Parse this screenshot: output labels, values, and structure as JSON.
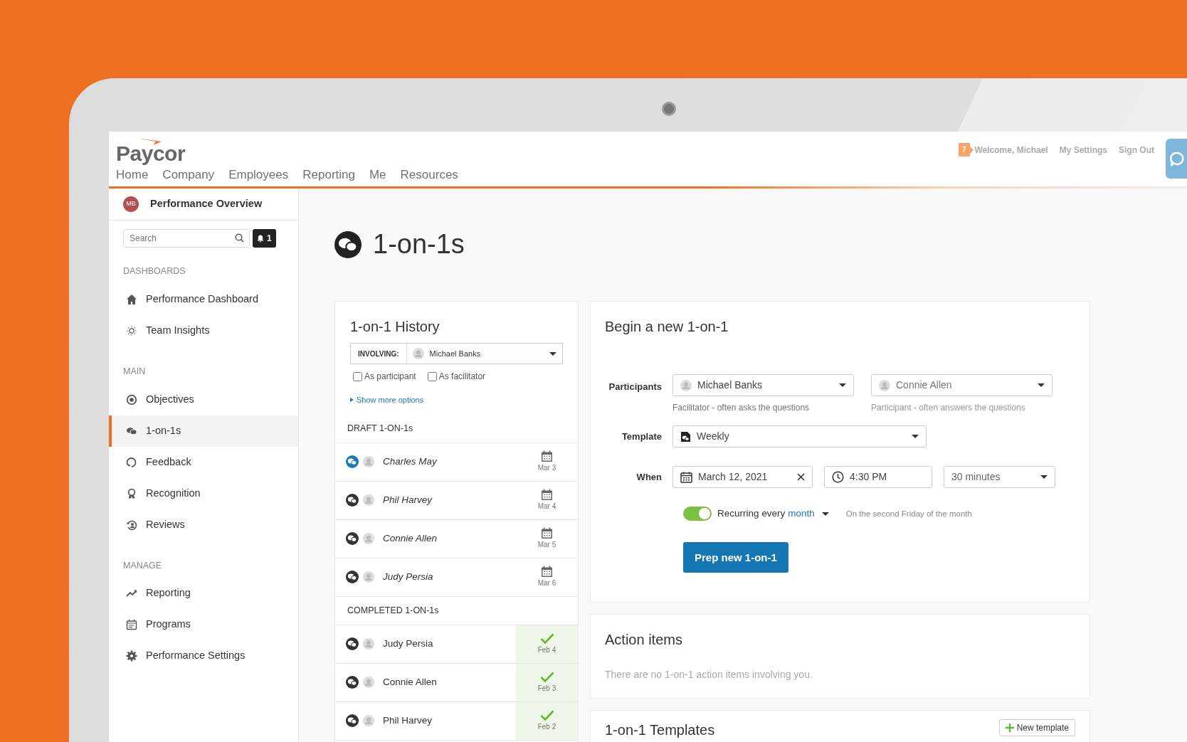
{
  "header": {
    "logo": "Paycor",
    "nav": [
      "Home",
      "Company",
      "Employees",
      "Reporting",
      "Me",
      "Resources"
    ],
    "notification_count": "7",
    "user_links": [
      "Welcome, Michael",
      "My Settings",
      "Sign Out"
    ]
  },
  "sidebar": {
    "user_initials": "MB",
    "title": "Performance Overview",
    "search": {
      "placeholder": "Search"
    },
    "alerts_count": "1",
    "sections": [
      {
        "heading": "DASHBOARDS",
        "items": [
          {
            "label": "Performance Dashboard",
            "selected": false
          },
          {
            "label": "Team Insights",
            "selected": false
          }
        ]
      },
      {
        "heading": "MAIN",
        "items": [
          {
            "label": "Objectives",
            "selected": false
          },
          {
            "label": "1-on-1s",
            "selected": true
          },
          {
            "label": "Feedback",
            "selected": false
          },
          {
            "label": "Recognition",
            "selected": false
          },
          {
            "label": "Reviews",
            "selected": false
          }
        ]
      },
      {
        "heading": "MANAGE",
        "items": [
          {
            "label": "Reporting",
            "selected": false
          },
          {
            "label": "Programs",
            "selected": false
          },
          {
            "label": "Performance Settings",
            "selected": false
          }
        ]
      }
    ]
  },
  "page_title": "1-on-1s",
  "history": {
    "title": "1-on-1 History",
    "filter_label": "INVOLVING:",
    "filter_person": "Michael Banks",
    "checkboxes": [
      {
        "label": "As participant",
        "checked": false
      },
      {
        "label": "As facilitator",
        "checked": false
      }
    ],
    "show_more": "Show more options",
    "groups": [
      {
        "heading": "DRAFT 1-ON-1s",
        "kind": "draft",
        "items": [
          {
            "name": "Charles May",
            "date": "Mar 3",
            "selected": true
          },
          {
            "name": "Phil Harvey",
            "date": "Mar 4",
            "selected": false
          },
          {
            "name": "Connie Allen",
            "date": "Mar 5",
            "selected": false
          },
          {
            "name": "Judy Persia",
            "date": "Mar 6",
            "selected": false
          }
        ]
      },
      {
        "heading": "COMPLETED 1-ON-1s",
        "kind": "completed",
        "items": [
          {
            "name": "Judy Persia",
            "date": "Feb 4",
            "selected": false
          },
          {
            "name": "Connie Allen",
            "date": "Feb 3",
            "selected": false
          },
          {
            "name": "Phil Harvey",
            "date": "Feb 2",
            "selected": false
          }
        ]
      }
    ]
  },
  "begin": {
    "title": "Begin a new 1-on-1",
    "participants_label": "Participants",
    "participants": [
      {
        "value": "Michael Banks",
        "hint": "Facilitator - often asks the questions"
      },
      {
        "value": "Connie Allen",
        "hint": "Participant - often answers the questions"
      }
    ],
    "template_label": "Template",
    "template": "Weekly",
    "when_label": "When",
    "date": "March 12, 2021",
    "time": "4:30 PM",
    "duration": "30 minutes",
    "recurring": {
      "on": true,
      "text": "Recurring every",
      "unit": "month",
      "note": "On the second Friday of the month"
    },
    "button": "Prep new 1-on-1"
  },
  "action_items": {
    "title": "Action items",
    "empty_text": "There are no 1-on-1 action items involving you."
  },
  "templates": {
    "title": "1-on-1 Templates",
    "button": "New template"
  }
}
